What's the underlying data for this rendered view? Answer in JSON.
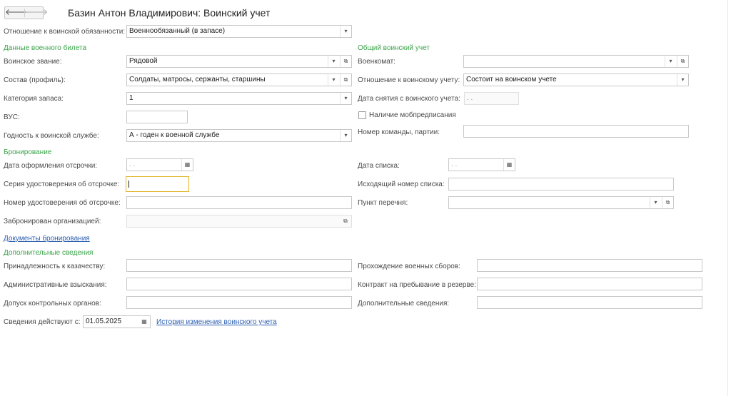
{
  "header": {
    "title": "Базин Антон Владимирович: Воинский учет",
    "back_icon": "arrow-left-icon",
    "forward_icon": "arrow-right-icon",
    "back_glyph": "🡐",
    "forward_glyph": "🡒"
  },
  "relation": {
    "label": "Отношение к воинской обязанности:",
    "value": "Военнообязанный (в запасе)"
  },
  "military_id": {
    "section": "Данные военного билета",
    "rank_label": "Воинское звание:",
    "rank_value": "Рядовой",
    "profile_label": "Состав (профиль):",
    "profile_value": "Солдаты, матросы, сержанты, старшины",
    "reserve_label": "Категория запаса:",
    "reserve_value": "1",
    "vus_label": "ВУС:",
    "vus_value": "",
    "fitness_label": "Годность к воинской службе:",
    "fitness_value": "А - годен к военной службе"
  },
  "general": {
    "section": "Общий воинский учет",
    "commissariat_label": "Военкомат:",
    "commissariat_value": "",
    "attitude_label": "Отношение к воинскому учету:",
    "attitude_value": "Состоит на воинском учете",
    "removal_date_label": "Дата снятия с воинского учета:",
    "removal_date_value": " .  .",
    "mob_label": "Наличие мобпредписания",
    "team_label": "Номер команды, партии:",
    "team_value": ""
  },
  "booking": {
    "section": "Бронирование",
    "deferral_date_label": "Дата оформления отсрочки:",
    "deferral_date_value": " .  .",
    "cert_series_label": "Серия удостоверения об отсрочке:",
    "cert_series_value": "",
    "cert_number_label": "Номер удостоверения об отсрочке:",
    "cert_number_value": "",
    "reserved_by_label": "Забронирован организацией:",
    "reserved_by_value": "",
    "list_date_label": "Дата списка:",
    "list_date_value": " .  .",
    "list_number_label": "Исходящий номер списка:",
    "list_number_value": "",
    "list_item_label": "Пункт перечня:",
    "list_item_value": "",
    "documents_link": "Документы бронирования"
  },
  "additional": {
    "section": "Дополнительные сведения",
    "cossack_label": "Принадлежность к казачеству:",
    "admin_label": "Административные взыскания:",
    "control_label": "Допуск контрольных органов:",
    "training_label": "Прохождение военных сборов:",
    "contract_label": "Контракт на пребывание в резерве:",
    "extra_label": "Дополнительные сведения:"
  },
  "footer": {
    "effective_label": "Сведения действуют с:",
    "effective_value": "01.05.2025",
    "history_link": "История изменения воинского учета"
  },
  "glyphs": {
    "dropdown": "▾",
    "open": "⧉",
    "calendar": "▦"
  }
}
